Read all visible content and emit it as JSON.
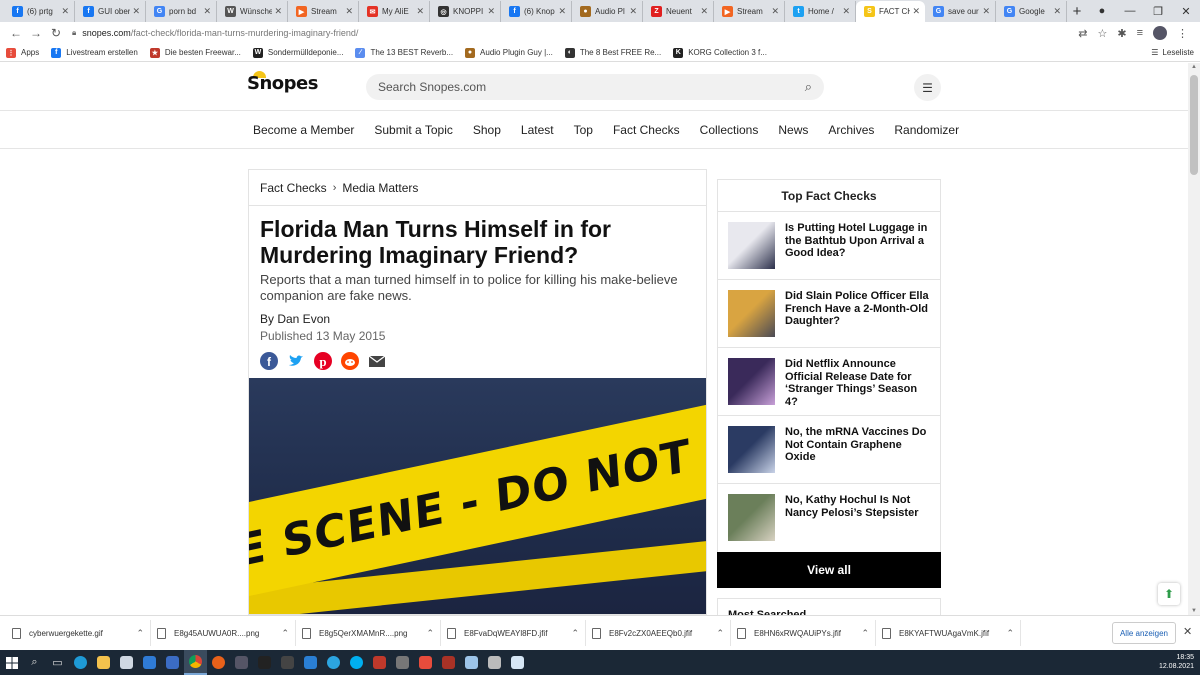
{
  "browser": {
    "tabs": [
      {
        "title": "(6) prtg",
        "color": "#1877f2",
        "glyph": "f"
      },
      {
        "title": "GUI ober",
        "color": "#1877f2",
        "glyph": "f"
      },
      {
        "title": "porn bd",
        "color": "#4285f4",
        "glyph": "G"
      },
      {
        "title": "Wünsche",
        "color": "#555555",
        "glyph": "W"
      },
      {
        "title": "Stream",
        "color": "#f26522",
        "glyph": "▶"
      },
      {
        "title": "My AliE",
        "color": "#e43225",
        "glyph": "✉"
      },
      {
        "title": "KNOPPI",
        "color": "#333333",
        "glyph": "◎"
      },
      {
        "title": "(6) Knop",
        "color": "#1877f2",
        "glyph": "f"
      },
      {
        "title": "Audio Pl",
        "color": "#a36a1f",
        "glyph": "●"
      },
      {
        "title": "Neuent",
        "color": "#e02020",
        "glyph": "Z"
      },
      {
        "title": "Stream",
        "color": "#f26522",
        "glyph": "▶"
      },
      {
        "title": "Home /",
        "color": "#1da1f2",
        "glyph": "t"
      },
      {
        "title": "FACT CH",
        "color": "#f5c518",
        "glyph": "S",
        "active": true
      },
      {
        "title": "save our",
        "color": "#4285f4",
        "glyph": "G"
      },
      {
        "title": "Google",
        "color": "#4285f4",
        "glyph": "G"
      }
    ],
    "url_host": "snopes.com",
    "url_path": "/fact-check/florida-man-turns-murdering-imaginary-friend/",
    "bookmarks": [
      {
        "label": "Apps",
        "color": "#e74c3c",
        "glyph": "⋮"
      },
      {
        "label": "Livestream erstellen",
        "color": "#1877f2",
        "glyph": "f"
      },
      {
        "label": "Die besten Freewar...",
        "color": "#c0392b",
        "glyph": "★"
      },
      {
        "label": "Sondermülldeponie...",
        "color": "#222222",
        "glyph": "W"
      },
      {
        "label": "The 13 BEST Reverb...",
        "color": "#5b8def",
        "glyph": "∕"
      },
      {
        "label": "Audio Plugin Guy |...",
        "color": "#a36a1f",
        "glyph": "●"
      },
      {
        "label": "The 8 Best FREE Re...",
        "color": "#333333",
        "glyph": "◐"
      },
      {
        "label": "KORG Collection 3 f...",
        "color": "#222222",
        "glyph": "K"
      }
    ],
    "reading_list": "Leseliste"
  },
  "site": {
    "logo": "Snopes",
    "search_placeholder": "Search Snopes.com",
    "nav": [
      "Become a Member",
      "Submit a Topic",
      "Shop",
      "Latest",
      "Top",
      "Fact Checks",
      "Collections",
      "News",
      "Archives",
      "Randomizer"
    ]
  },
  "article": {
    "breadcrumb": [
      "Fact Checks",
      "Media Matters"
    ],
    "title": "Florida Man Turns Himself in for Murdering Imaginary Friend?",
    "subtitle": "Reports that a man turned himself in to police for killing his make-believe companion are fake news.",
    "byline": "By Dan Evon",
    "published": "Published 13 May 2015",
    "hero_text": "CRIME SCENE - DO NOT ENTER"
  },
  "sidebar": {
    "title": "Top Fact Checks",
    "items": [
      {
        "title": "Is Putting Hotel Luggage in the Bathtub Upon Arrival a Good Idea?"
      },
      {
        "title": "Did Slain Police Officer Ella French Have a 2-Month-Old Daughter?"
      },
      {
        "title": "Did Netflix Announce Official Release Date for ‘Stranger Things’ Season 4?"
      },
      {
        "title": "No, the mRNA Vaccines Do Not Contain Graphene Oxide"
      },
      {
        "title": "No, Kathy Hochul Is Not Nancy Pelosi’s Stepsister"
      }
    ],
    "view_all": "View all",
    "most_searched": "Most Searched"
  },
  "downloads": {
    "files": [
      "cyberwuergekette.gif",
      "E8g45AUWUA0R....png",
      "E8g5QerXMAMnR....png",
      "E8FvaDqWEAYl8FD.jfif",
      "E8Fv2cZX0AEEQb0.jfif",
      "E8HN6xRWQAUiPYs.jfif",
      "E8KYAFTWUAgaVmK.jfif"
    ],
    "show_all": "Alle anzeigen"
  },
  "taskbar": {
    "time": "18:35",
    "date": "12.08.2021"
  }
}
